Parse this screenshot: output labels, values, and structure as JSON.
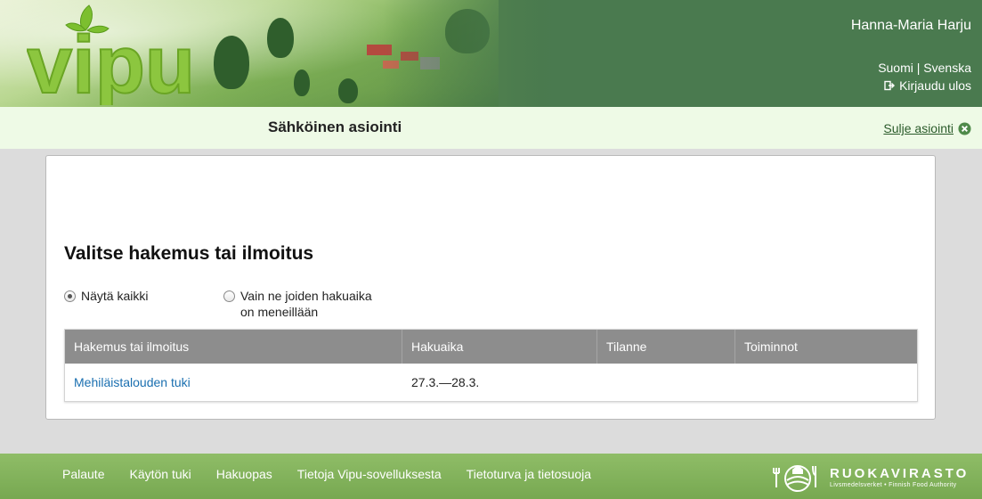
{
  "header": {
    "logo_text": "vipu",
    "user_name": "Hanna-Maria Harju",
    "lang_fi": "Suomi",
    "lang_sep": "|",
    "lang_sv": "Svenska",
    "logout_label": "Kirjaudu ulos"
  },
  "subbar": {
    "title": "Sähköinen asiointi",
    "close_label": "Sulje asiointi"
  },
  "main": {
    "title": "Valitse hakemus tai ilmoitus",
    "filters": [
      {
        "label": "Näytä kaikki",
        "checked": true
      },
      {
        "label_line1": "Vain ne joiden hakuaika",
        "label_line2": "on meneillään",
        "checked": false
      }
    ],
    "table": {
      "headers": [
        "Hakemus tai ilmoitus",
        "Hakuaika",
        "Tilanne",
        "Toiminnot"
      ],
      "rows": [
        {
          "name": "Mehiläistalouden tuki",
          "period": "27.3.—28.3.",
          "status": "",
          "actions": ""
        }
      ]
    }
  },
  "footer": {
    "links": [
      "Palaute",
      "Käytön tuki",
      "Hakuopas",
      "Tietoja Vipu-sovelluksesta",
      "Tietoturva ja tietosuoja"
    ],
    "brand_name": "RUOKAVIRASTO",
    "brand_sub": "Livsmedelsverket • Finnish Food Authority"
  },
  "colors": {
    "header_green": "#4a7a4f",
    "subbar_bg": "#eefae6",
    "table_header": "#8d8d8d",
    "link_blue": "#1a6fb0",
    "footer_green": "#82b35a"
  }
}
